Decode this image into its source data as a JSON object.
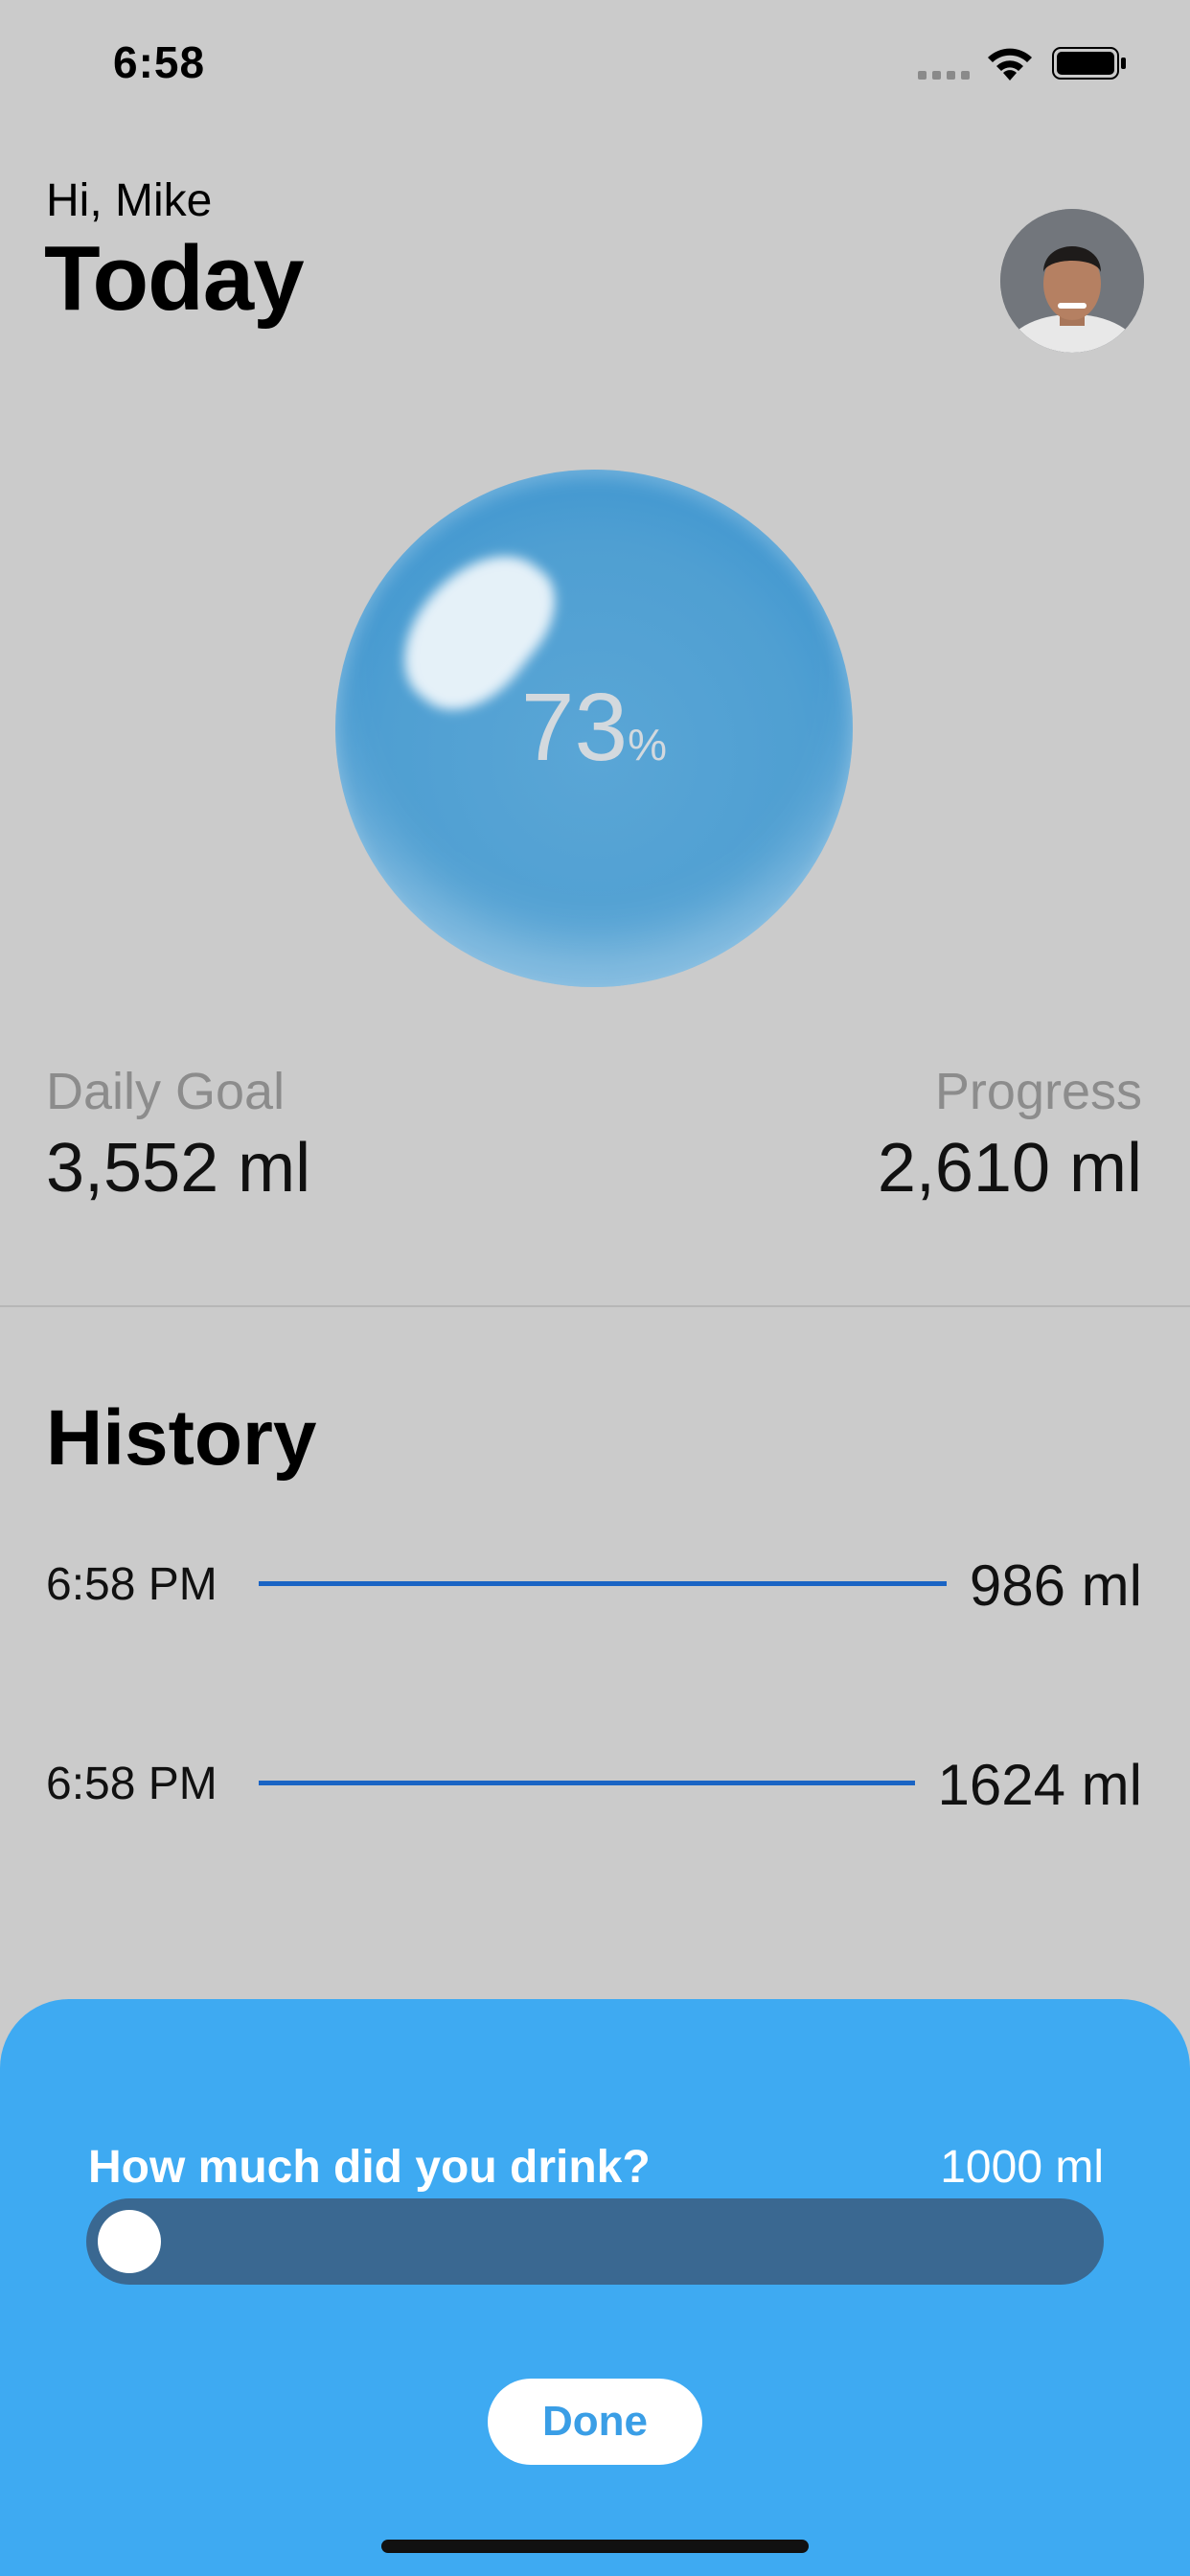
{
  "status_bar": {
    "time": "6:58"
  },
  "header": {
    "greeting": "Hi, Mike",
    "title": "Today"
  },
  "progress": {
    "percent_value": "73",
    "percent_unit": "%"
  },
  "stats": {
    "goal_label": "Daily Goal",
    "goal_value": "3,552 ml",
    "progress_label": "Progress",
    "progress_value": "2,610 ml"
  },
  "history": {
    "title": "History",
    "entries": [
      {
        "time": "6:58 PM",
        "amount": "986 ml",
        "line_fraction": 0.609
      },
      {
        "time": "6:58 PM",
        "amount": "1624 ml",
        "line_fraction": 1.0
      }
    ]
  },
  "sheet": {
    "question": "How much did you drink?",
    "amount": "1000 ml",
    "slider_fraction": 0.0,
    "done_label": "Done"
  },
  "colors": {
    "background": "#cbcbcb",
    "sheet": "#3eaaf2",
    "slider_track": "#3a6891",
    "history_line": "#1a64c4",
    "sphere": "#4f9fd2"
  },
  "icons": [
    "signal-icon",
    "wifi-icon",
    "battery-icon"
  ]
}
